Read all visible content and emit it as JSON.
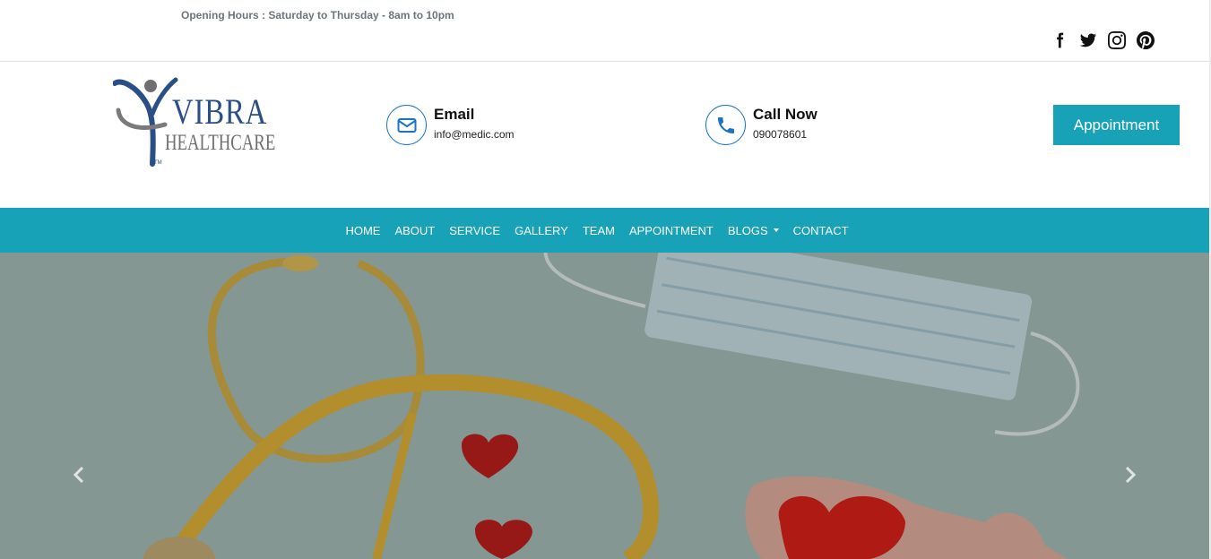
{
  "topbar": {
    "opening_hours": "Opening Hours : Saturday to Thursday - 8am to 10pm",
    "social_icons": [
      "facebook-icon",
      "twitter-icon",
      "instagram-icon",
      "pinterest-icon"
    ]
  },
  "header": {
    "logo": {
      "word1": "VIBRA",
      "word2": "HEALTHCARE",
      "tm": "TM"
    },
    "email": {
      "title": "Email",
      "value": "info@medic.com",
      "icon": "envelope-icon"
    },
    "call": {
      "title": "Call Now",
      "value": "090078601",
      "icon": "phone-icon"
    },
    "appointment_button": "Appointment"
  },
  "nav": {
    "items": [
      {
        "label": "HOME"
      },
      {
        "label": "ABOUT"
      },
      {
        "label": "SERVICE"
      },
      {
        "label": "GALLERY"
      },
      {
        "label": "TEAM"
      },
      {
        "label": "APPOINTMENT"
      },
      {
        "label": "BLOGS"
      },
      {
        "label": "CONTACT"
      }
    ]
  },
  "hero": {
    "prev_icon": "chevron-left-icon",
    "next_icon": "chevron-right-icon"
  },
  "colors": {
    "accent": "#17a2b8",
    "icon_blue": "#1a73c8",
    "hours_text": "#6c757d",
    "logo_blue": "#2a4e86"
  }
}
